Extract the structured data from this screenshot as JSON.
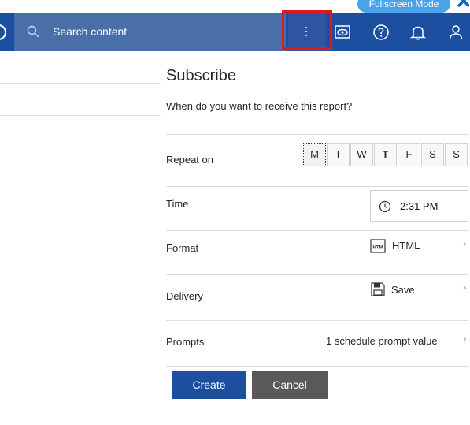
{
  "top": {
    "fullscreen_label": "Fullscreen Mode"
  },
  "header": {
    "search_placeholder": "Search content",
    "icons": [
      "search-icon",
      "kebab-menu-icon",
      "eye-icon",
      "help-icon",
      "notification-bell-icon",
      "user-icon"
    ],
    "colors": {
      "bar": "#1c4fa0",
      "search": "#4a6fa8",
      "highlight": "#e01b1b"
    }
  },
  "panel": {
    "title": "Subscribe",
    "subtitle": "When do you want to receive this report?",
    "repeat": {
      "label": "Repeat on",
      "days": [
        "M",
        "T",
        "W",
        "T",
        "F",
        "S",
        "S"
      ],
      "selected": "M"
    },
    "time": {
      "label": "Time",
      "value": "2:31 PM"
    },
    "format": {
      "label": "Format",
      "value": "HTML",
      "icon": "html-file-icon"
    },
    "delivery": {
      "label": "Delivery",
      "value": "Save",
      "icon": "save-disk-icon"
    },
    "prompts": {
      "label": "Prompts",
      "value": "1 schedule prompt value"
    },
    "buttons": {
      "create": "Create",
      "cancel": "Cancel"
    }
  }
}
